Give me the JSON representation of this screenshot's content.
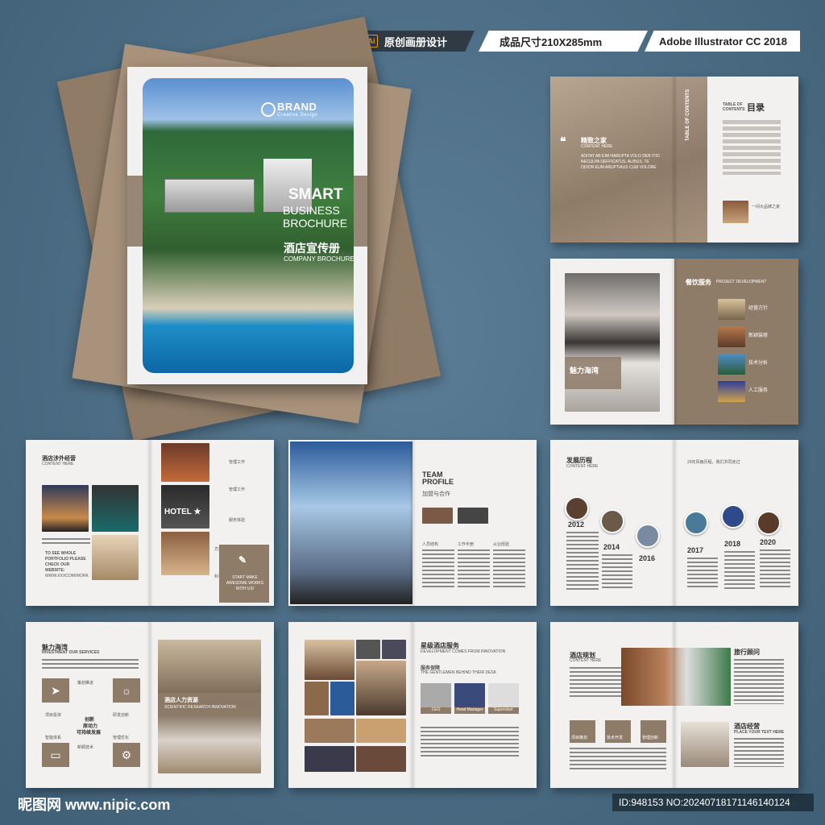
{
  "header_tags": {
    "ai_icon": "Ai",
    "design_type": "原创画册设计",
    "size": "成品尺寸210X285mm",
    "software": "Adobe Illustrator CC 2018"
  },
  "cover": {
    "brand": "BRAND",
    "brand_sub": "Creative Design",
    "title1": "SMART",
    "title2": "BUSINESS",
    "title3": "BROCHURE",
    "cn_title": "酒店宣传册",
    "en_sub": "COMPANY BROCHURE"
  },
  "toc_page": {
    "heading_cn": "精致之家",
    "heading_en": "CONTENT HERE",
    "quote": "ADITAT AB EIM HARUPTA VOLO DEB ITIO NECULPA DEFFICATUS. ALIBUS. TE ODION EUM ARUPTIAUS CUM VOLORE",
    "side_label": "TABLE OF CONTENTS",
    "toc_en": "TABLE OF CONTENTS",
    "toc_cn": "目录",
    "caption": "一间大品牌之家"
  },
  "catering_page": {
    "title": "餐饮服务",
    "title_en": "PROJECT DEVELOPMENT",
    "overlay": "魅力海湾",
    "items": [
      "经营方针",
      "新颖装修",
      "技术分析",
      "人工服务"
    ]
  },
  "overseas_page": {
    "title": "酒店涉外经营",
    "sub": "CONTENT HERE",
    "cta_left": "TO SEE WHOLE PORTFOLIO PLEASE CHECK OUR WEBSITE:",
    "url": "WWW.XXXCOM/WORK",
    "hotel_sign": "HOTEL ★",
    "labels": [
      "管理工作",
      "管理工作",
      "服务体验",
      "方案设计",
      "科学研究"
    ],
    "cta_right": "START MAKE AWESOME WORKS WITH US!"
  },
  "team_page": {
    "title1": "TEAM",
    "title2": "PROFILE",
    "cn": "加盟与合作",
    "cols": [
      "人员结构",
      "工作手册",
      "从业经验"
    ]
  },
  "history_page": {
    "title": "发展历程",
    "sub": "CONTENT HERE",
    "note": "20年风雨历程，我们共同走过",
    "years": [
      "2012",
      "2014",
      "2016",
      "2017",
      "2018",
      "2020"
    ]
  },
  "bay_page": {
    "title": "魅力海湾",
    "sub": "INVESTMENT OUR SERVICES",
    "center1": "创新",
    "center2": "原动力",
    "center3": "可持续发展",
    "labels": [
      "策划推进",
      "项目投资",
      "新颖技术",
      "研发创新",
      "管理优化",
      "智能体系"
    ],
    "hr_title": "酒店人力资源",
    "hr_sub": "SCIENTIFIC RESEARCH INNOVATION"
  },
  "star_page": {
    "title": "星级酒店服务",
    "sub": "DEVELOPMENT COMES FROM INNOVATION",
    "guarantee": "服务保障",
    "guarantee_sub": "THE GENTLEMEN BEHIND THEIR DESK",
    "caps": [
      "CEO",
      "Head Manager",
      "Supervisor"
    ]
  },
  "plan_page": {
    "title": "酒店规划",
    "sub": "CONTENT HERE",
    "travel": "旅行顾问",
    "manage": "酒店经营",
    "manage_sub": "PLACE YOUR TEXT HERE",
    "boxes": [
      "项目策划",
      "技术开发",
      "管理创新"
    ]
  },
  "watermark": {
    "left": "昵图网 www.nipic.com",
    "right": "ID:948153 NO:20240718171146140124"
  }
}
